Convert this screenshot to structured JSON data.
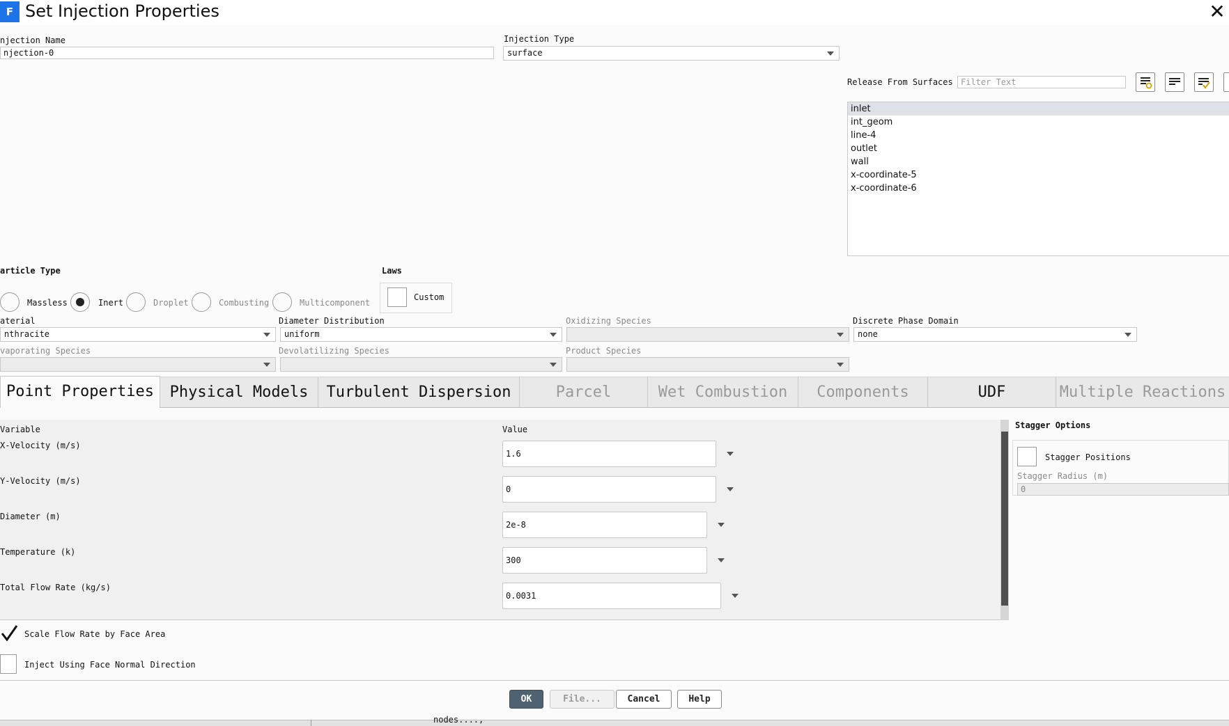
{
  "window": {
    "title": "Set Injection Properties",
    "app_icon_letter": "F"
  },
  "injection_name": {
    "label": "njection Name",
    "value": "njection-0"
  },
  "injection_type": {
    "label": "Injection Type",
    "value": "surface"
  },
  "release_from_surfaces": {
    "label": "Release From Surfaces",
    "filter_placeholder": "Filter Text",
    "items": [
      "inlet",
      "int_geom",
      "line-4",
      "outlet",
      "wall",
      "x-coordinate-5",
      "x-coordinate-6"
    ],
    "selected": "inlet"
  },
  "particle_type": {
    "label": "article Type",
    "options": [
      "Massless",
      "Inert",
      "Droplet",
      "Combusting",
      "Multicomponent"
    ],
    "selected": "Inert"
  },
  "laws": {
    "label": "Laws",
    "custom_label": "Custom"
  },
  "material": {
    "label": "aterial",
    "value": "nthracite"
  },
  "diameter_distribution": {
    "label": "Diameter Distribution",
    "value": "uniform"
  },
  "oxidizing_species": {
    "label": "Oxidizing Species",
    "value": ""
  },
  "discrete_phase_domain": {
    "label": "Discrete Phase Domain",
    "value": "none"
  },
  "evaporating_species": {
    "label": "vaporating Species",
    "value": ""
  },
  "devolatilizing_species": {
    "label": "Devolatilizing Species",
    "value": ""
  },
  "product_species": {
    "label": "Product Species",
    "value": ""
  },
  "tabs": [
    {
      "label": "Point Properties",
      "state": "active"
    },
    {
      "label": "Physical Models",
      "state": "normal"
    },
    {
      "label": "Turbulent Dispersion",
      "state": "normal"
    },
    {
      "label": "Parcel",
      "state": "disabled"
    },
    {
      "label": "Wet Combustion",
      "state": "disabled"
    },
    {
      "label": "Components",
      "state": "disabled"
    },
    {
      "label": "UDF",
      "state": "normal"
    },
    {
      "label": "Multiple Reactions",
      "state": "disabled"
    }
  ],
  "point_properties": {
    "variable_header": "Variable",
    "value_header": "Value",
    "rows": [
      {
        "variable": "X-Velocity (m/s)",
        "value": "1.6"
      },
      {
        "variable": "Y-Velocity (m/s)",
        "value": "0"
      },
      {
        "variable": "Diameter (m)",
        "value": "2e-8"
      },
      {
        "variable": "Temperature (k)",
        "value": "300"
      },
      {
        "variable": "Total Flow Rate (kg/s)",
        "value": "0.0031"
      }
    ]
  },
  "stagger_options": {
    "label": "Stagger Options",
    "positions_label": "Stagger Positions",
    "radius_label": "Stagger Radius (m)",
    "radius_value": "0"
  },
  "options": {
    "scale_flow_rate": {
      "label": "Scale Flow Rate by Face Area",
      "checked": true
    },
    "inject_face_normal": {
      "label": "Inject Using Face Normal Direction",
      "checked": false
    }
  },
  "buttons": {
    "ok": "OK",
    "file": "File...",
    "cancel": "Cancel",
    "help": "Help"
  },
  "console_fragment": "nodes....,",
  "colors": {
    "primary_button": "#4e6271",
    "app_icon": "#1e73e8",
    "selected_item": "#dde1e8"
  }
}
